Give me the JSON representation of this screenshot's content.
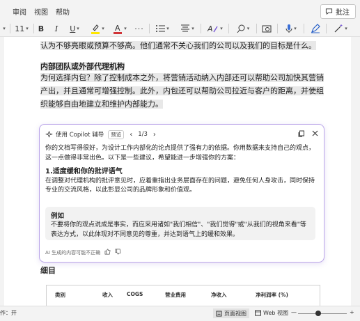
{
  "menu": {
    "items": [
      "审阅",
      "视图",
      "帮助"
    ],
    "comment_label": "批注"
  },
  "toolbar": {
    "font_size": "11",
    "bold": "B",
    "italic": "I",
    "underline": "U",
    "more": "···"
  },
  "document": {
    "para_top": "认为不够亮眼或预算不够高。他们通常不关心我们的公司以及我们的目标是什么。",
    "heading": "内部团队或外部代理机构",
    "para_main": "为何选择内包？除了控制成本之外，将营销活动纳入内部还可以帮助公司加快其营销产出，并且通常可增强控制。此外，内包还可以帮助公司拉近与客户的距离，并使组织能够自由地建立和维护内部能力。",
    "detail_heading": "细目"
  },
  "copilot": {
    "title": "使用 Copilot 辅导",
    "badge": "预览",
    "pager": "1/3",
    "intro": "你的文档写得很好，为设计工作内部化的论点提供了强有力的依据。你用数据来支持自己的观点，这一点做得非常出色。以下是一些建议，希望能进一步增强你的方案：",
    "suggestion_title": "1.适度缓和你的批评语气",
    "suggestion_text": "在调整对代理机构的批评意见时，应着重指出业务层面存在的问题，避免任何人身攻击，同时保持专业的交流风格，以此彰显公司的品牌形象和价值观。",
    "example_title": "例如",
    "example_text": "不要将你的观点说成是事实，而应采用诸如\"我们相信\"、\"我们觉得\"或\"从我们的视角来看\"等表达方式，以此体现对不同意见的尊重，并达到语气上的缓和效果。",
    "footer": "AI 生成的内容可能不正确"
  },
  "table": {
    "headers": [
      "类别",
      "收入",
      "COGS",
      "营业费用",
      "净收入",
      "净利润率 (%)"
    ]
  },
  "statusbar": {
    "left": "作：开",
    "page_view": "页面视图",
    "web_view": "Web 视图",
    "zoom_minus": "—",
    "zoom_plus": "+"
  },
  "colors": {
    "accent": "#7b5cd6",
    "highlight_yellow": "#ffe600",
    "font_red": "#d13438"
  }
}
